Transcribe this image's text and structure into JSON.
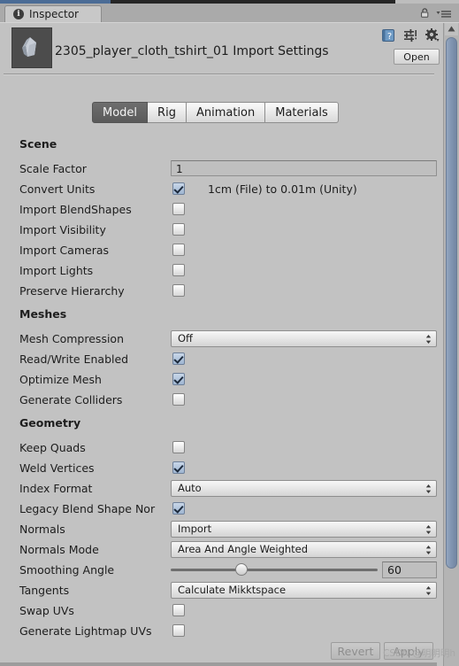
{
  "window": {
    "tab_label": "Inspector",
    "info_icon": "info-icon",
    "lock_icon": "lock-icon",
    "menu_icon": "menu-icon"
  },
  "asset": {
    "title": "2305_player_cloth_tshirt_01 Import Settings",
    "thumbnail_icon": "mesh-preview-thumbnail",
    "help_icon": "help-book-icon",
    "preset_icon": "preset-icon",
    "gear_icon": "gear-icon",
    "open_label": "Open"
  },
  "tabs": [
    {
      "label": "Model",
      "active": true
    },
    {
      "label": "Rig",
      "active": false
    },
    {
      "label": "Animation",
      "active": false
    },
    {
      "label": "Materials",
      "active": false
    }
  ],
  "sections": [
    {
      "title": "Scene",
      "rows": [
        {
          "label": "Scale Factor",
          "type": "text",
          "value": "1"
        },
        {
          "label": "Convert Units",
          "type": "checkbox",
          "checked": true,
          "note": "1cm (File) to 0.01m (Unity)"
        },
        {
          "label": "Import BlendShapes",
          "type": "checkbox",
          "checked": false
        },
        {
          "label": "Import Visibility",
          "type": "checkbox",
          "checked": false
        },
        {
          "label": "Import Cameras",
          "type": "checkbox",
          "checked": false
        },
        {
          "label": "Import Lights",
          "type": "checkbox",
          "checked": false
        },
        {
          "label": "Preserve Hierarchy",
          "type": "checkbox",
          "checked": false
        }
      ]
    },
    {
      "title": "Meshes",
      "rows": [
        {
          "label": "Mesh Compression",
          "type": "dropdown",
          "value": "Off"
        },
        {
          "label": "Read/Write Enabled",
          "type": "checkbox",
          "checked": true
        },
        {
          "label": "Optimize Mesh",
          "type": "checkbox",
          "checked": true
        },
        {
          "label": "Generate Colliders",
          "type": "checkbox",
          "checked": false
        }
      ]
    },
    {
      "title": "Geometry",
      "rows": [
        {
          "label": "Keep Quads",
          "type": "checkbox",
          "checked": false
        },
        {
          "label": "Weld Vertices",
          "type": "checkbox",
          "checked": true
        },
        {
          "label": "Index Format",
          "type": "dropdown",
          "value": "Auto"
        },
        {
          "label": "Legacy Blend Shape Nor",
          "type": "checkbox",
          "checked": true
        },
        {
          "label": "Normals",
          "type": "dropdown",
          "value": "Import"
        },
        {
          "label": "Normals Mode",
          "type": "dropdown",
          "value": "Area And Angle Weighted"
        },
        {
          "label": "Smoothing Angle",
          "type": "slider",
          "value": "60",
          "percent": 34
        },
        {
          "label": "Tangents",
          "type": "dropdown",
          "value": "Calculate Mikktspace"
        },
        {
          "label": "Swap UVs",
          "type": "checkbox",
          "checked": false
        },
        {
          "label": "Generate Lightmap UVs",
          "type": "checkbox",
          "checked": false
        }
      ]
    }
  ],
  "footer": {
    "revert_label": "Revert",
    "apply_label": "Apply"
  },
  "watermark": "CSDN @明明明h"
}
